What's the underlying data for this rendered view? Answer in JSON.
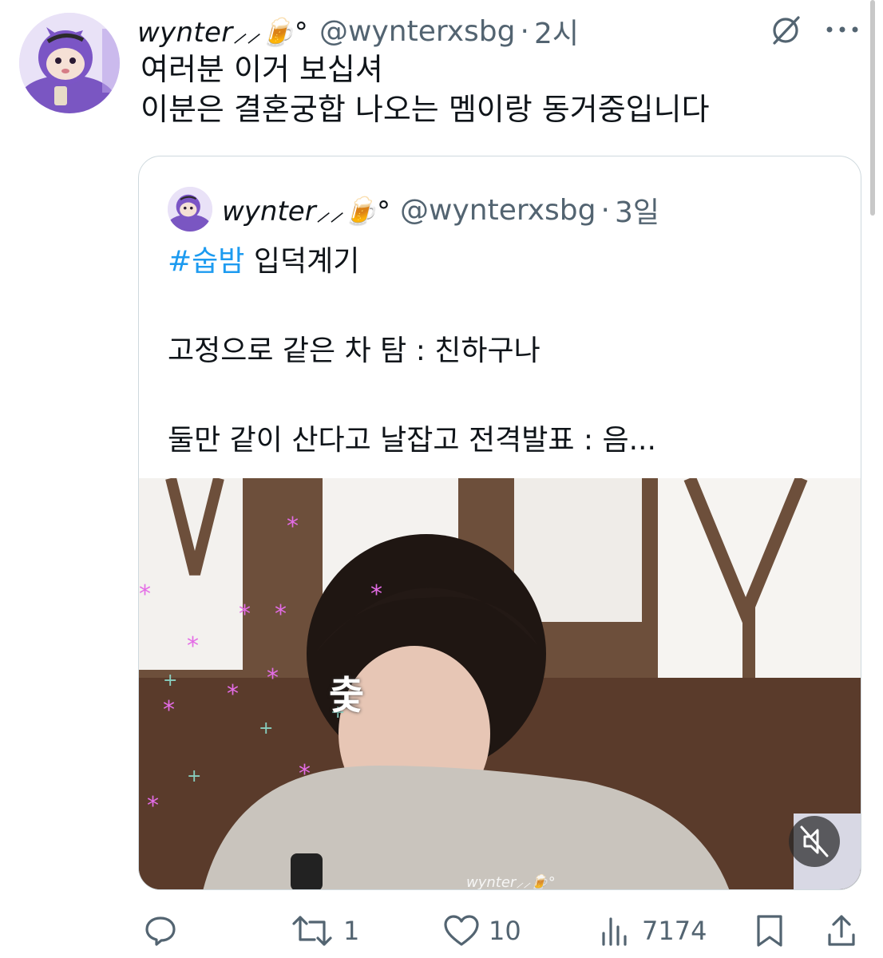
{
  "tweet": {
    "display_name": "wynter⸝⸝🍺°",
    "handle": "@wynterxsbg",
    "separator": "·",
    "time": "2시",
    "text_lines": [
      "여러분 이거 보십셔",
      "이분은 결혼궁합 나오는 멤이랑 동거중입니다"
    ]
  },
  "quote": {
    "display_name": "wynter⸝⸝🍺°",
    "handle": "@wynterxsbg",
    "separator": "·",
    "time": "3일",
    "hashtag": "#숩밤",
    "line1_rest": " 입덕계기",
    "line2": "고정으로 같은 차 탐 : 친하구나",
    "line3": "둘만 같이 산다고 날잡고 전격발표 : 음...",
    "media_overlay_char": "춫",
    "media_watermark": "wynter⸝⸝🍺°"
  },
  "actions": {
    "reply_icon": "reply-icon",
    "retweet_count": "1",
    "like_count": "10",
    "views_count": "7174",
    "bookmark_icon": "bookmark-icon",
    "share_icon": "share-icon"
  },
  "colors": {
    "link": "#1d9bf0",
    "muted": "#536471",
    "text": "#0f1419",
    "border": "#cfd9de"
  }
}
